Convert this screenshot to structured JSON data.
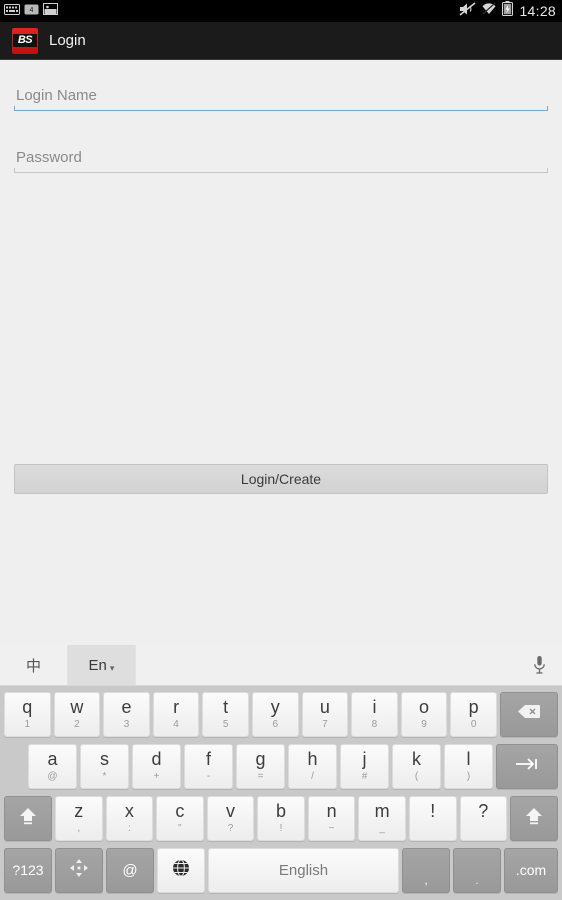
{
  "statusbar": {
    "left_icons": [
      "keyboard-icon",
      "sd-card-icon",
      "screenshot-image-icon"
    ],
    "right_icons": [
      "mute-icon",
      "wifi-icon",
      "battery-charging-icon"
    ],
    "clock": "14:28"
  },
  "appbar": {
    "logo_text": "BS",
    "logo_color": "#d41f1f",
    "title": "Login"
  },
  "form": {
    "login_name": {
      "value": "",
      "placeholder": "Login Name",
      "focused": true
    },
    "password": {
      "value": "",
      "placeholder": "Password",
      "focused": false
    },
    "submit_label": "Login/Create"
  },
  "keyboard": {
    "tabs": [
      {
        "label": "中",
        "name": "tab-chinese",
        "selected": false
      },
      {
        "label": "En",
        "name": "tab-english",
        "selected": true,
        "caret": "▾"
      }
    ],
    "mic_icon": "microphone-icon",
    "row1": [
      {
        "main": "q",
        "sub": "1"
      },
      {
        "main": "w",
        "sub": "2"
      },
      {
        "main": "e",
        "sub": "3"
      },
      {
        "main": "r",
        "sub": "4"
      },
      {
        "main": "t",
        "sub": "5"
      },
      {
        "main": "y",
        "sub": "6"
      },
      {
        "main": "u",
        "sub": "7"
      },
      {
        "main": "i",
        "sub": "8"
      },
      {
        "main": "o",
        "sub": "9"
      },
      {
        "main": "p",
        "sub": "0"
      }
    ],
    "row1_action": {
      "name": "backspace-key",
      "icon": "backspace-icon"
    },
    "row2": [
      {
        "main": "a",
        "sub": "@"
      },
      {
        "main": "s",
        "sub": "*"
      },
      {
        "main": "d",
        "sub": "+"
      },
      {
        "main": "f",
        "sub": "-"
      },
      {
        "main": "g",
        "sub": "="
      },
      {
        "main": "h",
        "sub": "/"
      },
      {
        "main": "j",
        "sub": "#"
      },
      {
        "main": "k",
        "sub": "("
      },
      {
        "main": "l",
        "sub": ")"
      }
    ],
    "row2_action": {
      "name": "enter-key",
      "icon": "tab-arrow-icon"
    },
    "row3_shift_left": {
      "name": "shift-key-left",
      "icon": "shift-icon"
    },
    "row3": [
      {
        "main": "z",
        "sub": ","
      },
      {
        "main": "x",
        "sub": ":"
      },
      {
        "main": "c",
        "sub": "\""
      },
      {
        "main": "v",
        "sub": "?"
      },
      {
        "main": "b",
        "sub": "!"
      },
      {
        "main": "n",
        "sub": "~"
      },
      {
        "main": "m",
        "sub": "_"
      },
      {
        "main": "!",
        "sub": ""
      },
      {
        "main": "?",
        "sub": ""
      }
    ],
    "row3_shift_right": {
      "name": "shift-key-right",
      "icon": "shift-icon"
    },
    "row4": {
      "numeric_label": "?123",
      "arrow_icon": "arrow-cursor-icon",
      "at_label": "@",
      "globe_icon": "globe-language-icon",
      "space_label": "English",
      "comma_label": ",",
      "period_label": ".",
      "com_label": ".com"
    }
  }
}
